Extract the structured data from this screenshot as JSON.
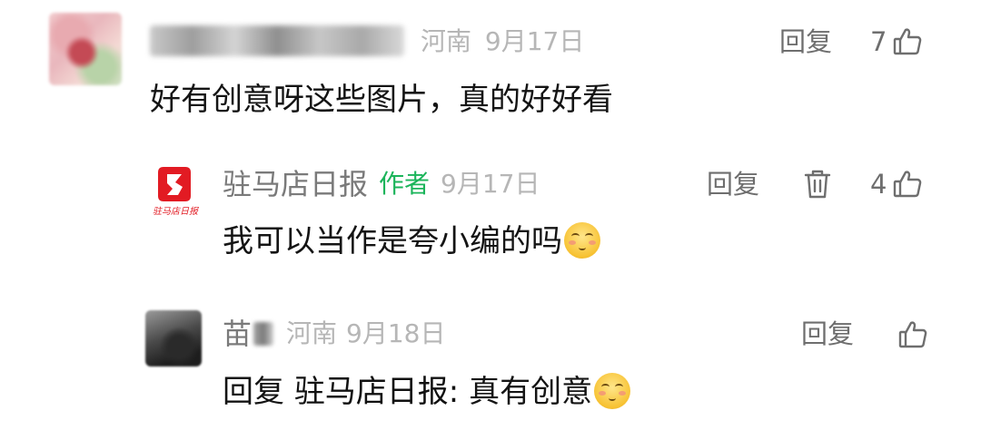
{
  "comments": [
    {
      "location": "河南",
      "date": "9月17日",
      "reply_label": "回复",
      "like_count": "7",
      "text": "好有创意呀这些图片，真的好好看"
    }
  ],
  "replies": [
    {
      "name": "驻马店日报",
      "author_tag": "作者",
      "date": "9月17日",
      "reply_label": "回复",
      "like_count": "4",
      "text": "我可以当作是夸小编的吗",
      "avatar_caption": "驻马店日报"
    },
    {
      "name": "苗",
      "location": "河南",
      "date": "9月18日",
      "reply_label": "回复",
      "text_prefix": "回复",
      "text_target": "驻马店日报:",
      "text": "真有创意"
    }
  ],
  "colors": {
    "author_tag": "#1bb45a",
    "reply_target": "#6e6e6e",
    "meta": "#b6b6b6",
    "logo_red": "#e21b23"
  },
  "icons": [
    "thumbs-up-icon",
    "trash-icon",
    "shy-smile-emoji"
  ]
}
